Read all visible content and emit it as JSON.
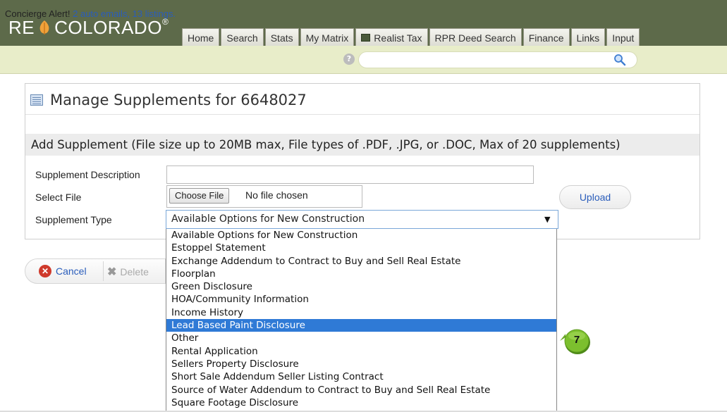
{
  "header": {
    "logo_prefix": "RE",
    "logo_suffix": "COLORADO",
    "logo_mark": "®",
    "nav": [
      "Home",
      "Search",
      "Stats",
      "My Matrix",
      "Realist Tax",
      "RPR Deed Search",
      "Finance",
      "Links",
      "Input"
    ]
  },
  "alert": {
    "label": "Concierge Alert!",
    "link_text": "2 auto emails, 13 listings."
  },
  "search": {
    "placeholder": ""
  },
  "panel": {
    "title": "Manage Supplements for 6648027",
    "add_heading": "Add Supplement (File size up to 20MB max, File types of .PDF, .JPG, or .DOC, Max of 20 supplements)",
    "labels": {
      "description": "Supplement Description",
      "file": "Select File",
      "type": "Supplement Type"
    },
    "description_value": "",
    "choose_file_label": "Choose File",
    "file_status": "No file chosen",
    "upload_label": "Upload",
    "type_selected": "Available Options for New Construction"
  },
  "dropdown": {
    "selected_index": 7,
    "options": [
      "Available Options for New Construction",
      "Estoppel Statement",
      "Exchange Addendum to Contract to Buy and Sell Real Estate",
      "Floorplan",
      "Green Disclosure",
      "HOA/Community Information",
      "Income History",
      "Lead Based Paint Disclosure",
      "Other",
      "Rental Application",
      "Sellers Property Disclosure",
      "Short Sale Addendum Seller Listing Contract",
      "Source of Water Addendum to Contract to Buy and Sell Real Estate",
      "Square Footage Disclosure"
    ]
  },
  "buttons": {
    "cancel": "Cancel",
    "delete": "Delete"
  },
  "badge": {
    "number": "7",
    "color": "#7cbf2e"
  },
  "icons": {
    "help": "help-icon",
    "search": "search-icon",
    "realist": "realist-icon",
    "title": "table-icon",
    "cancel": "cancel-icon",
    "delete": "delete-icon",
    "leaf": "leaf-icon"
  }
}
